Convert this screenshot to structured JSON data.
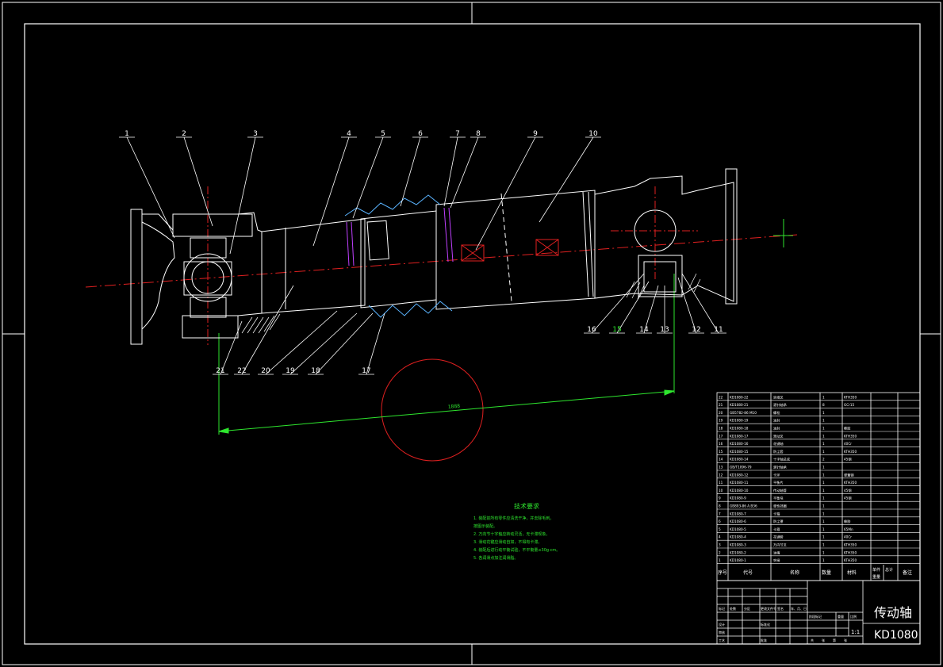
{
  "drawing": {
    "title": "传动轴",
    "code": "KD1080",
    "scale": "1:1",
    "dimension_1": "1888"
  },
  "balloons": [
    "1",
    "2",
    "3",
    "4",
    "5",
    "6",
    "7",
    "8",
    "9",
    "10",
    "11",
    "12",
    "13",
    "14",
    "15",
    "16",
    "17",
    "18",
    "19",
    "20",
    "21",
    "22"
  ],
  "tech_notes": {
    "heading": "技术要求",
    "lines": [
      "1. 装配前所有零件应清洗干净，并去除毛刺。",
      "   按图示装配。",
      "2. 万向节十字轴应转动灵活，无卡滞现象。",
      "3. 滑动花键应滑动自如，不得有卡滞。",
      "4. 装配后进行动平衡试验，不平衡量≤30g·cm。",
      "5. 各润滑点加注润滑脂。"
    ]
  },
  "bom": {
    "headers": [
      "序号",
      "代号",
      "名称",
      "数量",
      "材料",
      "单件",
      "总计",
      "备注"
    ],
    "mass_header": "重量",
    "rows": [
      [
        "22",
        "KD1080-22",
        "突缘叉",
        "1",
        "KTH350",
        ""
      ],
      [
        "21",
        "KD1080-21",
        "滚针轴承",
        "8",
        "GCr15",
        ""
      ],
      [
        "20",
        "GB5782-86 M10",
        "螺栓",
        "1",
        "",
        ""
      ],
      [
        "19",
        "KD1080-19",
        "油封",
        "1",
        "",
        ""
      ],
      [
        "18",
        "KD1080-18",
        "油封",
        "1",
        "橡胶",
        ""
      ],
      [
        "17",
        "KD1080-17",
        "滑动叉",
        "1",
        "KTH350",
        ""
      ],
      [
        "16",
        "KD1080-16",
        "花键轴",
        "1",
        "40Cr",
        ""
      ],
      [
        "15",
        "KD1080-15",
        "防尘套",
        "1",
        "KTH350",
        ""
      ],
      [
        "14",
        "KD1080-14",
        "十字轴总成",
        "2",
        "45钢",
        ""
      ],
      [
        "13",
        "GB/T1096-79",
        "滚针轴承",
        "1",
        "",
        ""
      ],
      [
        "12",
        "KD1080-12",
        "卡环",
        "1",
        "弹簧钢",
        ""
      ],
      [
        "11",
        "KD1080-11",
        "平衡片",
        "1",
        "KTH350",
        ""
      ],
      [
        "10",
        "KD1080-10",
        "传动轴管",
        "1",
        "45钢",
        ""
      ],
      [
        "9",
        "KD1080-9",
        "平衡块",
        "1",
        "45钢",
        ""
      ],
      [
        "8",
        "GB893-86 A.B36",
        "弹性挡圈",
        "1",
        "",
        ""
      ],
      [
        "7",
        "KD1080-7",
        "卡箍",
        "1",
        "",
        ""
      ],
      [
        "6",
        "KD1080-6",
        "防尘罩",
        "1",
        "橡胶",
        ""
      ],
      [
        "5",
        "KD1080-5",
        "卡箍",
        "1",
        "65Mn",
        ""
      ],
      [
        "4",
        "KD1080-4",
        "花键套",
        "1",
        "40Cr",
        ""
      ],
      [
        "3",
        "KD1080-3",
        "万向节叉",
        "1",
        "KTH350",
        ""
      ],
      [
        "2",
        "KD1080-2",
        "油嘴",
        "1",
        "KTH350",
        ""
      ],
      [
        "1",
        "KD1080-1",
        "突缘",
        "1",
        "KTH350",
        ""
      ]
    ]
  },
  "title_block": {
    "labels": [
      "标记",
      "处数",
      "分区",
      "更改文件号",
      "签名",
      "年、月、日",
      "设计",
      "标准化",
      "阶段标记",
      "重量",
      "比例",
      "审核",
      "工艺",
      "批准",
      "共",
      "张",
      "第",
      "张"
    ]
  }
}
